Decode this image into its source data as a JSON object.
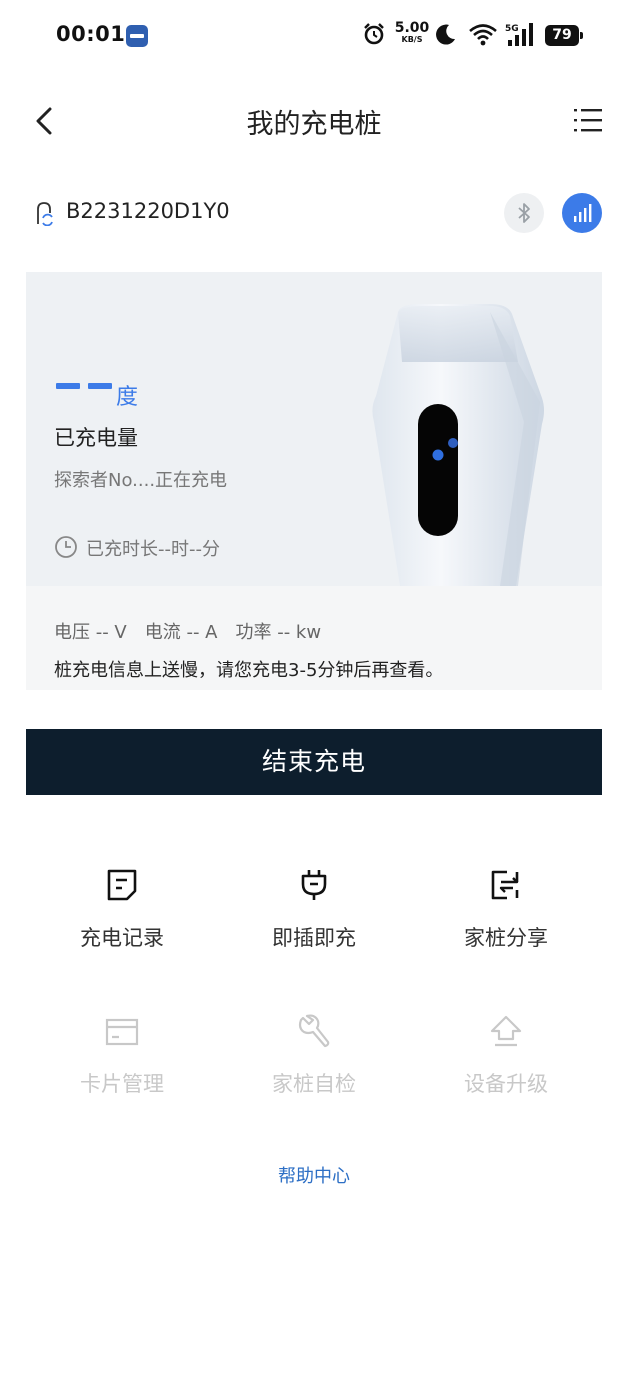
{
  "status_bar": {
    "time": "00:01",
    "speed_value": "5.00",
    "speed_unit": "KB/S",
    "network": "5G",
    "battery": "79"
  },
  "header": {
    "title": "我的充电桩"
  },
  "device": {
    "id": "B2231220D1Y0"
  },
  "charging": {
    "amount_unit": "度",
    "amount_label": "已充电量",
    "status": "探索者No....正在充电",
    "duration": "已充时长--时--分",
    "voltage": "电压 -- V",
    "current": "电流 -- A",
    "power": "功率 -- kw",
    "notice": "桩充电信息上送慢，请您充电3-5分钟后再查看。"
  },
  "actions": {
    "end_label": "结束充电"
  },
  "features": [
    {
      "label": "充电记录",
      "icon": "record-icon",
      "enabled": true
    },
    {
      "label": "即插即充",
      "icon": "plug-icon",
      "enabled": true
    },
    {
      "label": "家桩分享",
      "icon": "share-icon",
      "enabled": true
    },
    {
      "label": "卡片管理",
      "icon": "card-icon",
      "enabled": false
    },
    {
      "label": "家桩自检",
      "icon": "wrench-icon",
      "enabled": false
    },
    {
      "label": "设备升级",
      "icon": "upgrade-icon",
      "enabled": false
    }
  ],
  "help": {
    "label": "帮助中心"
  },
  "colors": {
    "accent": "#3c7be8",
    "end_button": "#0d1e2d",
    "help_link": "#2d6fc5",
    "disabled": "#c8c8c8"
  }
}
